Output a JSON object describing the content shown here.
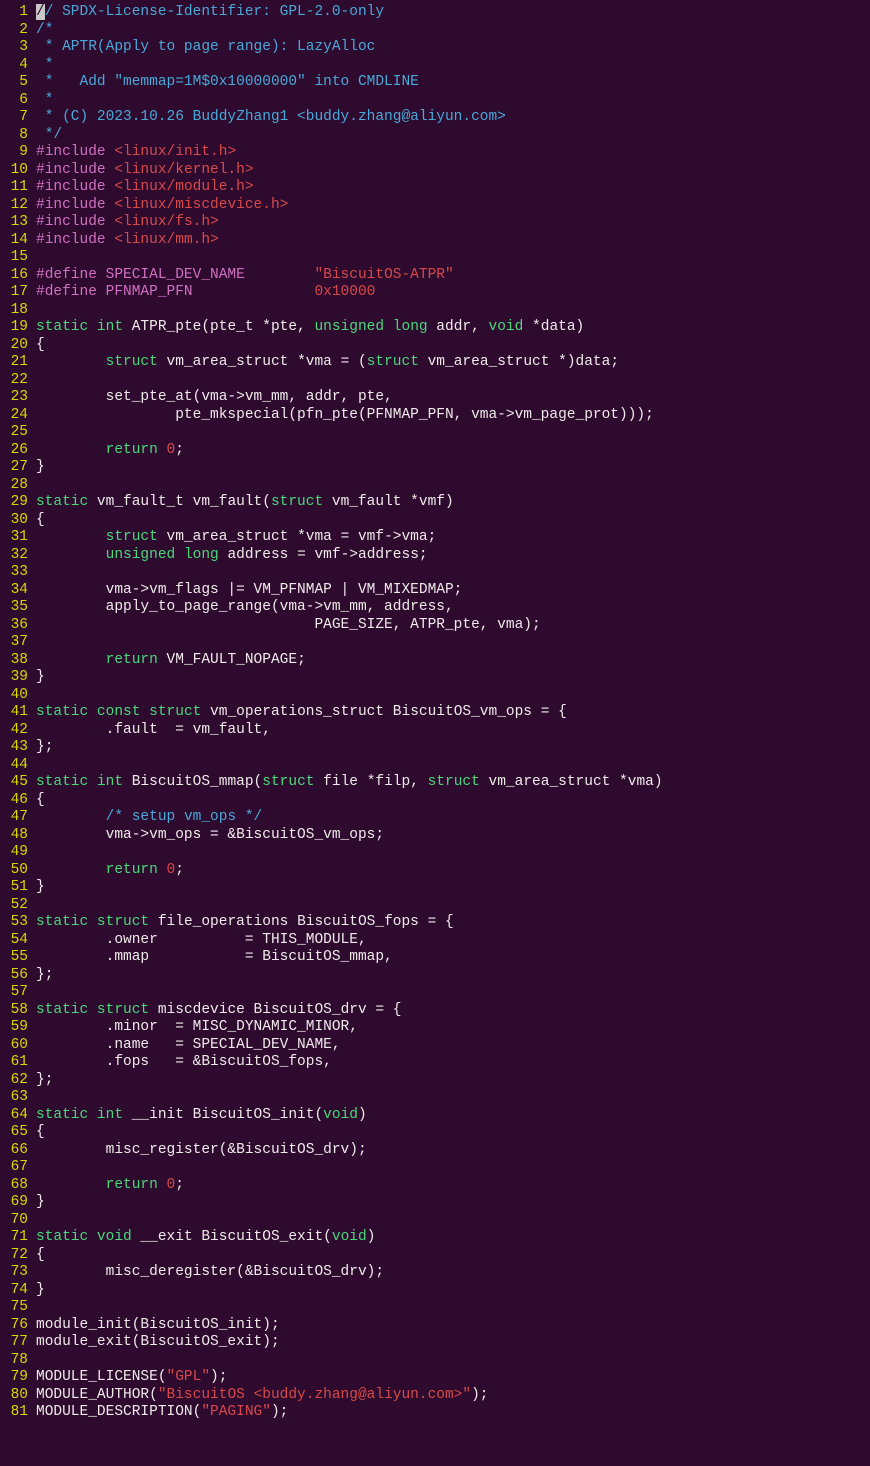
{
  "lines": [
    {
      "n": 1,
      "tokens": [
        {
          "t": "/",
          "c": "cursor-block"
        },
        {
          "t": "/ SPDX-License-Identifier: GPL-2.0-only",
          "c": "comment"
        }
      ]
    },
    {
      "n": 2,
      "tokens": [
        {
          "t": "/*",
          "c": "comment"
        }
      ]
    },
    {
      "n": 3,
      "tokens": [
        {
          "t": " * APTR(Apply to page range): LazyAlloc",
          "c": "comment"
        }
      ]
    },
    {
      "n": 4,
      "tokens": [
        {
          "t": " *",
          "c": "comment"
        }
      ]
    },
    {
      "n": 5,
      "tokens": [
        {
          "t": " *   Add \"memmap=1M$0x10000000\" into CMDLINE",
          "c": "comment"
        }
      ]
    },
    {
      "n": 6,
      "tokens": [
        {
          "t": " *",
          "c": "comment"
        }
      ]
    },
    {
      "n": 7,
      "tokens": [
        {
          "t": " * (C) 2023.10.26 BuddyZhang1 <buddy.zhang@aliyun.com>",
          "c": "comment"
        }
      ]
    },
    {
      "n": 8,
      "tokens": [
        {
          "t": " */",
          "c": "comment"
        }
      ]
    },
    {
      "n": 9,
      "tokens": [
        {
          "t": "#include ",
          "c": "preproc"
        },
        {
          "t": "<linux/init.h>",
          "c": "string"
        }
      ]
    },
    {
      "n": 10,
      "tokens": [
        {
          "t": "#include ",
          "c": "preproc"
        },
        {
          "t": "<linux/kernel.h>",
          "c": "string"
        }
      ]
    },
    {
      "n": 11,
      "tokens": [
        {
          "t": "#include ",
          "c": "preproc"
        },
        {
          "t": "<linux/module.h>",
          "c": "string"
        }
      ]
    },
    {
      "n": 12,
      "tokens": [
        {
          "t": "#include ",
          "c": "preproc"
        },
        {
          "t": "<linux/miscdevice.h>",
          "c": "string"
        }
      ]
    },
    {
      "n": 13,
      "tokens": [
        {
          "t": "#include ",
          "c": "preproc"
        },
        {
          "t": "<linux/fs.h>",
          "c": "string"
        }
      ]
    },
    {
      "n": 14,
      "tokens": [
        {
          "t": "#include ",
          "c": "preproc"
        },
        {
          "t": "<linux/mm.h>",
          "c": "string"
        }
      ]
    },
    {
      "n": 15,
      "tokens": []
    },
    {
      "n": 16,
      "tokens": [
        {
          "t": "#define SPECIAL_DEV_NAME        ",
          "c": "preproc"
        },
        {
          "t": "\"BiscuitOS-ATPR\"",
          "c": "string"
        }
      ]
    },
    {
      "n": 17,
      "tokens": [
        {
          "t": "#define PFNMAP_PFN              ",
          "c": "preproc"
        },
        {
          "t": "0x10000",
          "c": "string"
        }
      ]
    },
    {
      "n": 18,
      "tokens": []
    },
    {
      "n": 19,
      "tokens": [
        {
          "t": "static",
          "c": "keyword"
        },
        {
          "t": " ",
          "c": "text"
        },
        {
          "t": "int",
          "c": "keyword"
        },
        {
          "t": " ATPR_pte(pte_t *pte, ",
          "c": "text"
        },
        {
          "t": "unsigned",
          "c": "keyword"
        },
        {
          "t": " ",
          "c": "text"
        },
        {
          "t": "long",
          "c": "keyword"
        },
        {
          "t": " addr, ",
          "c": "text"
        },
        {
          "t": "void",
          "c": "keyword"
        },
        {
          "t": " *data)",
          "c": "text"
        }
      ]
    },
    {
      "n": 20,
      "tokens": [
        {
          "t": "{",
          "c": "text"
        }
      ]
    },
    {
      "n": 21,
      "tokens": [
        {
          "t": "        ",
          "c": "text"
        },
        {
          "t": "struct",
          "c": "keyword"
        },
        {
          "t": " vm_area_struct *vma = (",
          "c": "text"
        },
        {
          "t": "struct",
          "c": "keyword"
        },
        {
          "t": " vm_area_struct *)data;",
          "c": "text"
        }
      ]
    },
    {
      "n": 22,
      "tokens": []
    },
    {
      "n": 23,
      "tokens": [
        {
          "t": "        set_pte_at(vma->vm_mm, addr, pte,",
          "c": "text"
        }
      ]
    },
    {
      "n": 24,
      "tokens": [
        {
          "t": "                pte_mkspecial(pfn_pte(PFNMAP_PFN, vma->vm_page_prot)));",
          "c": "text"
        }
      ]
    },
    {
      "n": 25,
      "tokens": []
    },
    {
      "n": 26,
      "tokens": [
        {
          "t": "        ",
          "c": "text"
        },
        {
          "t": "return",
          "c": "keyword"
        },
        {
          "t": " ",
          "c": "text"
        },
        {
          "t": "0",
          "c": "number"
        },
        {
          "t": ";",
          "c": "text"
        }
      ]
    },
    {
      "n": 27,
      "tokens": [
        {
          "t": "}",
          "c": "text"
        }
      ]
    },
    {
      "n": 28,
      "tokens": []
    },
    {
      "n": 29,
      "tokens": [
        {
          "t": "static",
          "c": "keyword"
        },
        {
          "t": " vm_fault_t vm_fault(",
          "c": "text"
        },
        {
          "t": "struct",
          "c": "keyword"
        },
        {
          "t": " vm_fault *vmf)",
          "c": "text"
        }
      ]
    },
    {
      "n": 30,
      "tokens": [
        {
          "t": "{",
          "c": "text"
        }
      ]
    },
    {
      "n": 31,
      "tokens": [
        {
          "t": "        ",
          "c": "text"
        },
        {
          "t": "struct",
          "c": "keyword"
        },
        {
          "t": " vm_area_struct *vma = vmf->vma;",
          "c": "text"
        }
      ]
    },
    {
      "n": 32,
      "tokens": [
        {
          "t": "        ",
          "c": "text"
        },
        {
          "t": "unsigned",
          "c": "keyword"
        },
        {
          "t": " ",
          "c": "text"
        },
        {
          "t": "long",
          "c": "keyword"
        },
        {
          "t": " address = vmf->address;",
          "c": "text"
        }
      ]
    },
    {
      "n": 33,
      "tokens": []
    },
    {
      "n": 34,
      "tokens": [
        {
          "t": "        vma->vm_flags |= VM_PFNMAP | VM_MIXEDMAP;",
          "c": "text"
        }
      ]
    },
    {
      "n": 35,
      "tokens": [
        {
          "t": "        apply_to_page_range(vma->vm_mm, address,",
          "c": "text"
        }
      ]
    },
    {
      "n": 36,
      "tokens": [
        {
          "t": "                                PAGE_SIZE, ATPR_pte, vma);",
          "c": "text"
        }
      ]
    },
    {
      "n": 37,
      "tokens": []
    },
    {
      "n": 38,
      "tokens": [
        {
          "t": "        ",
          "c": "text"
        },
        {
          "t": "return",
          "c": "keyword"
        },
        {
          "t": " VM_FAULT_NOPAGE;",
          "c": "text"
        }
      ]
    },
    {
      "n": 39,
      "tokens": [
        {
          "t": "}",
          "c": "text"
        }
      ]
    },
    {
      "n": 40,
      "tokens": []
    },
    {
      "n": 41,
      "tokens": [
        {
          "t": "static",
          "c": "keyword"
        },
        {
          "t": " ",
          "c": "text"
        },
        {
          "t": "const",
          "c": "keyword"
        },
        {
          "t": " ",
          "c": "text"
        },
        {
          "t": "struct",
          "c": "keyword"
        },
        {
          "t": " vm_operations_struct BiscuitOS_vm_ops = {",
          "c": "text"
        }
      ]
    },
    {
      "n": 42,
      "tokens": [
        {
          "t": "        .fault  = vm_fault,",
          "c": "text"
        }
      ]
    },
    {
      "n": 43,
      "tokens": [
        {
          "t": "};",
          "c": "text"
        }
      ]
    },
    {
      "n": 44,
      "tokens": []
    },
    {
      "n": 45,
      "tokens": [
        {
          "t": "static",
          "c": "keyword"
        },
        {
          "t": " ",
          "c": "text"
        },
        {
          "t": "int",
          "c": "keyword"
        },
        {
          "t": " BiscuitOS_mmap(",
          "c": "text"
        },
        {
          "t": "struct",
          "c": "keyword"
        },
        {
          "t": " file *filp, ",
          "c": "text"
        },
        {
          "t": "struct",
          "c": "keyword"
        },
        {
          "t": " vm_area_struct *vma)",
          "c": "text"
        }
      ]
    },
    {
      "n": 46,
      "tokens": [
        {
          "t": "{",
          "c": "text"
        }
      ]
    },
    {
      "n": 47,
      "tokens": [
        {
          "t": "        ",
          "c": "text"
        },
        {
          "t": "/* setup vm_ops */",
          "c": "comment"
        }
      ]
    },
    {
      "n": 48,
      "tokens": [
        {
          "t": "        vma->vm_ops = &BiscuitOS_vm_ops;",
          "c": "text"
        }
      ]
    },
    {
      "n": 49,
      "tokens": []
    },
    {
      "n": 50,
      "tokens": [
        {
          "t": "        ",
          "c": "text"
        },
        {
          "t": "return",
          "c": "keyword"
        },
        {
          "t": " ",
          "c": "text"
        },
        {
          "t": "0",
          "c": "number"
        },
        {
          "t": ";",
          "c": "text"
        }
      ]
    },
    {
      "n": 51,
      "tokens": [
        {
          "t": "}",
          "c": "text"
        }
      ]
    },
    {
      "n": 52,
      "tokens": []
    },
    {
      "n": 53,
      "tokens": [
        {
          "t": "static",
          "c": "keyword"
        },
        {
          "t": " ",
          "c": "text"
        },
        {
          "t": "struct",
          "c": "keyword"
        },
        {
          "t": " file_operations BiscuitOS_fops = {",
          "c": "text"
        }
      ]
    },
    {
      "n": 54,
      "tokens": [
        {
          "t": "        .owner          = THIS_MODULE,",
          "c": "text"
        }
      ]
    },
    {
      "n": 55,
      "tokens": [
        {
          "t": "        .mmap           = BiscuitOS_mmap,",
          "c": "text"
        }
      ]
    },
    {
      "n": 56,
      "tokens": [
        {
          "t": "};",
          "c": "text"
        }
      ]
    },
    {
      "n": 57,
      "tokens": []
    },
    {
      "n": 58,
      "tokens": [
        {
          "t": "static",
          "c": "keyword"
        },
        {
          "t": " ",
          "c": "text"
        },
        {
          "t": "struct",
          "c": "keyword"
        },
        {
          "t": " miscdevice BiscuitOS_drv = {",
          "c": "text"
        }
      ]
    },
    {
      "n": 59,
      "tokens": [
        {
          "t": "        .minor  = MISC_DYNAMIC_MINOR,",
          "c": "text"
        }
      ]
    },
    {
      "n": 60,
      "tokens": [
        {
          "t": "        .name   = SPECIAL_DEV_NAME,",
          "c": "text"
        }
      ]
    },
    {
      "n": 61,
      "tokens": [
        {
          "t": "        .fops   = &BiscuitOS_fops,",
          "c": "text"
        }
      ]
    },
    {
      "n": 62,
      "tokens": [
        {
          "t": "};",
          "c": "text"
        }
      ]
    },
    {
      "n": 63,
      "tokens": []
    },
    {
      "n": 64,
      "tokens": [
        {
          "t": "static",
          "c": "keyword"
        },
        {
          "t": " ",
          "c": "text"
        },
        {
          "t": "int",
          "c": "keyword"
        },
        {
          "t": " __init BiscuitOS_init(",
          "c": "text"
        },
        {
          "t": "void",
          "c": "keyword"
        },
        {
          "t": ")",
          "c": "text"
        }
      ]
    },
    {
      "n": 65,
      "tokens": [
        {
          "t": "{",
          "c": "text"
        }
      ]
    },
    {
      "n": 66,
      "tokens": [
        {
          "t": "        misc_register(&BiscuitOS_drv);",
          "c": "text"
        }
      ]
    },
    {
      "n": 67,
      "tokens": []
    },
    {
      "n": 68,
      "tokens": [
        {
          "t": "        ",
          "c": "text"
        },
        {
          "t": "return",
          "c": "keyword"
        },
        {
          "t": " ",
          "c": "text"
        },
        {
          "t": "0",
          "c": "number"
        },
        {
          "t": ";",
          "c": "text"
        }
      ]
    },
    {
      "n": 69,
      "tokens": [
        {
          "t": "}",
          "c": "text"
        }
      ]
    },
    {
      "n": 70,
      "tokens": []
    },
    {
      "n": 71,
      "tokens": [
        {
          "t": "static",
          "c": "keyword"
        },
        {
          "t": " ",
          "c": "text"
        },
        {
          "t": "void",
          "c": "keyword"
        },
        {
          "t": " __exit BiscuitOS_exit(",
          "c": "text"
        },
        {
          "t": "void",
          "c": "keyword"
        },
        {
          "t": ")",
          "c": "text"
        }
      ]
    },
    {
      "n": 72,
      "tokens": [
        {
          "t": "{",
          "c": "text"
        }
      ]
    },
    {
      "n": 73,
      "tokens": [
        {
          "t": "        misc_deregister(&BiscuitOS_drv);",
          "c": "text"
        }
      ]
    },
    {
      "n": 74,
      "tokens": [
        {
          "t": "}",
          "c": "text"
        }
      ]
    },
    {
      "n": 75,
      "tokens": []
    },
    {
      "n": 76,
      "tokens": [
        {
          "t": "module_init(BiscuitOS_init);",
          "c": "text"
        }
      ]
    },
    {
      "n": 77,
      "tokens": [
        {
          "t": "module_exit(BiscuitOS_exit);",
          "c": "text"
        }
      ]
    },
    {
      "n": 78,
      "tokens": []
    },
    {
      "n": 79,
      "tokens": [
        {
          "t": "MODULE_LICENSE(",
          "c": "text"
        },
        {
          "t": "\"GPL\"",
          "c": "string"
        },
        {
          "t": ");",
          "c": "text"
        }
      ]
    },
    {
      "n": 80,
      "tokens": [
        {
          "t": "MODULE_AUTHOR(",
          "c": "text"
        },
        {
          "t": "\"BiscuitOS <buddy.zhang@aliyun.com>\"",
          "c": "string"
        },
        {
          "t": ");",
          "c": "text"
        }
      ]
    },
    {
      "n": 81,
      "tokens": [
        {
          "t": "MODULE_DESCRIPTION(",
          "c": "text"
        },
        {
          "t": "\"PAGING\"",
          "c": "string"
        },
        {
          "t": ");",
          "c": "text"
        }
      ]
    }
  ]
}
